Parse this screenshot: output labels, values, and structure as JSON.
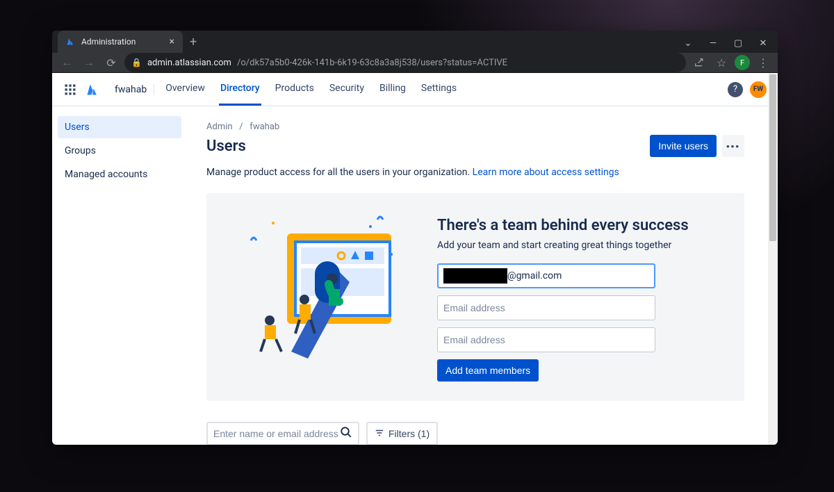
{
  "browser": {
    "tab_title": "Administration",
    "url_host": "admin.atlassian.com",
    "url_path": "/o/dk57a5b0-426k-141b-6k19-63c8a3a8j538/users?status=ACTIVE",
    "profile_initial": "F"
  },
  "topnav": {
    "org": "fwahab",
    "tabs": [
      "Overview",
      "Directory",
      "Products",
      "Security",
      "Billing",
      "Settings"
    ],
    "active_tab": "Directory",
    "user_initials": "FW"
  },
  "sidebar": {
    "items": [
      "Users",
      "Groups",
      "Managed accounts"
    ],
    "active": "Users"
  },
  "breadcrumb": {
    "root": "Admin",
    "leaf": "fwahab"
  },
  "page": {
    "title": "Users",
    "invite_btn": "Invite users",
    "desc": "Manage product access for all the users in your organization. ",
    "desc_link": "Learn more about access settings"
  },
  "card": {
    "title": "There's a team behind every success",
    "subtitle": "Add your team and start creating great things together",
    "email1_suffix": "@gmail.com",
    "email_placeholder": "Email address",
    "add_btn": "Add team members"
  },
  "filters": {
    "search_placeholder": "Enter name or email address",
    "filter_label": "Filters (1)"
  }
}
